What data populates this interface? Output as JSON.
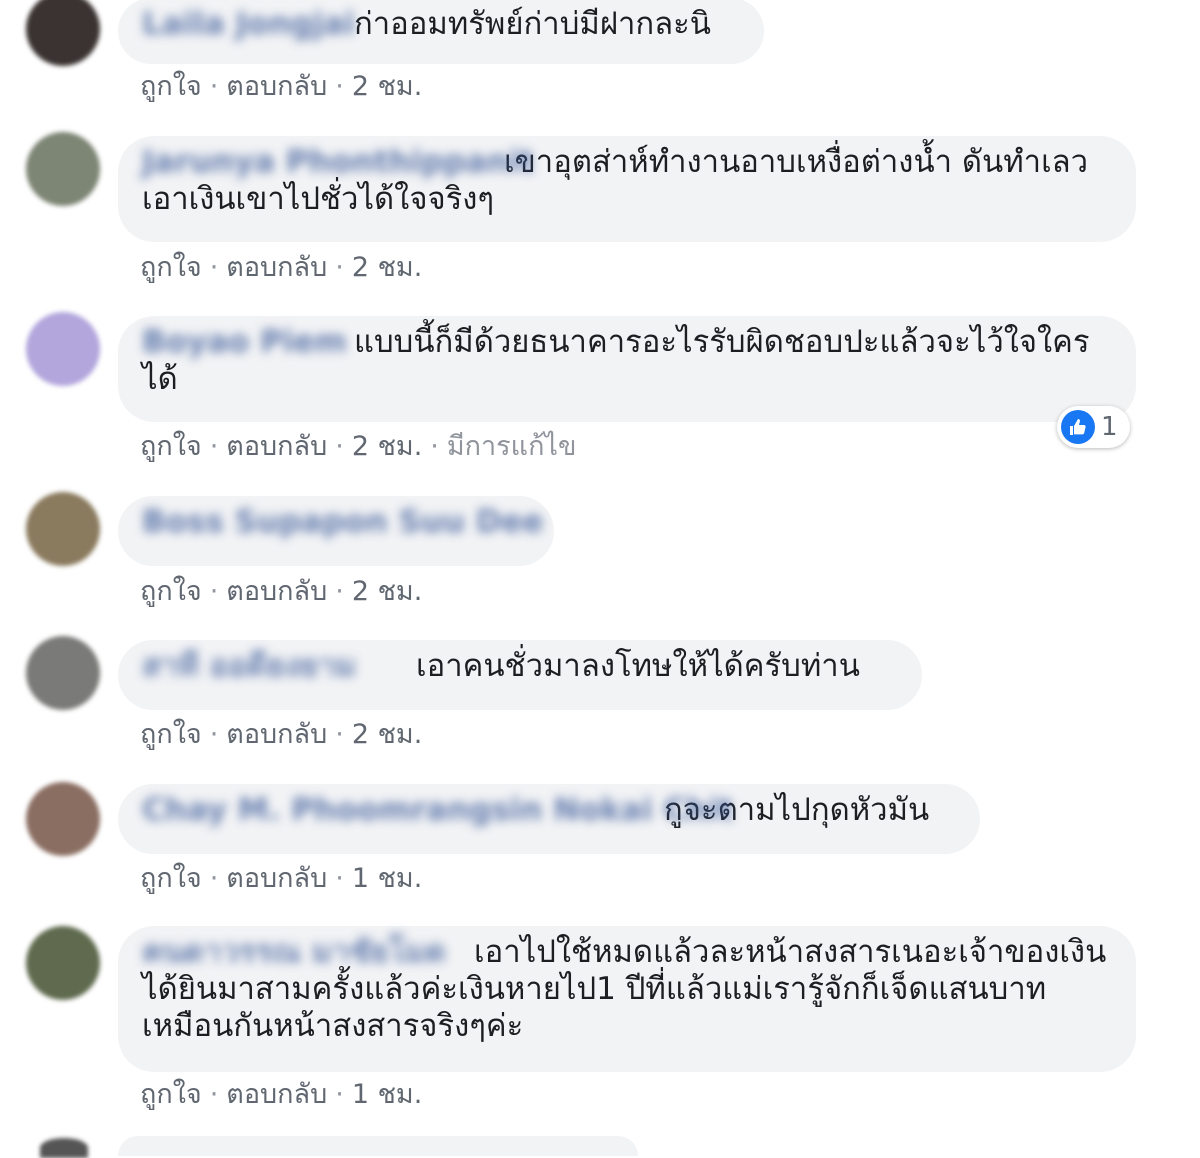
{
  "actions": {
    "like": "ถูกใจ",
    "reply": "ตอบกลับ",
    "separator": "·"
  },
  "comments": [
    {
      "author": "Laila Jongjai",
      "text": "ก่าออมทรัพย์ก่าบ่มีฝากละนิ",
      "time": "2 ชม.",
      "avatar_color": "#3a3331"
    },
    {
      "author": "Jarunya Phonthippanit",
      "text": "เขาอุตส่าห์ทำงานอาบเหงื่อต่างน้ำ ดันทำเลวเอาเงินเขาไปชั่วได้ใจจริงๆ",
      "time": "2 ชม.",
      "avatar_color": "#7d8574"
    },
    {
      "author": "Boyao Piem",
      "text": "แบบนี้ก็มีด้วยธนาคารอะไรรับผิดชอบปะแล้วจะไว้ใจใครได้",
      "time": "2 ชม.",
      "edited": "มีการแก้ไข",
      "avatar_color": "#b2a6dc",
      "reaction": {
        "icon": "thumbs-up-icon",
        "count": "1"
      }
    },
    {
      "author": "Boss Supapon Suu Dee",
      "text": "",
      "time": "2 ชม.",
      "avatar_color": "#8a7a5e"
    },
    {
      "author": "สาที ออดียงยาม",
      "text": "เอาคนชั่วมาลงโทษให้ได้ครับท่าน",
      "time": "2 ชม.",
      "avatar_color": "#7a7a78"
    },
    {
      "author": "Chay M. Phoomrangsin Nokai Chit",
      "text": "กูจะตามไปกุดหัวมัน",
      "time": "1 ชม.",
      "avatar_color": "#8b6e62"
    },
    {
      "author": "คนดาวรรณ มาชัยโมด",
      "text": "เอาไปใช้หมดแล้วละหน้าสงสารเนอะเจ้าของเงินได้ยินมาสามครั้งแล้วค่ะเงินหายไป1 ปีที่แล้วแม่เรารู้จักก็เจ็ดแสนบาทเหมือนกันหน้าสงสารจริงๆค่ะ",
      "time": "1 ชม.",
      "avatar_color": "#5f6a4e"
    }
  ]
}
